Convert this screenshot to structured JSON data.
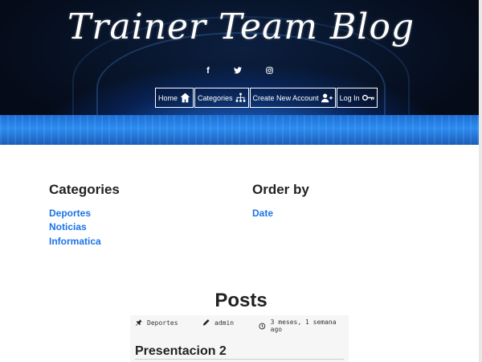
{
  "header": {
    "brand": "Trainer Team Blog",
    "social": [
      {
        "icon": "facebook-icon",
        "glyph": "f"
      },
      {
        "icon": "twitter-icon"
      },
      {
        "icon": "instagram-icon"
      }
    ],
    "nav": [
      {
        "label": "Home",
        "icon": "home-icon"
      },
      {
        "label": "Categories",
        "icon": "sitemap-icon"
      },
      {
        "label": "Create New Account",
        "icon": "user-plus-icon"
      },
      {
        "label": "Log In",
        "icon": "key-icon"
      }
    ]
  },
  "categories": {
    "title": "Categories",
    "items": [
      "Deportes",
      "Noticias",
      "Informatica"
    ]
  },
  "order_by": {
    "title": "Order by",
    "items": [
      "Date"
    ]
  },
  "posts": {
    "title": "Posts",
    "items": [
      {
        "category": "Deportes",
        "author": "admin",
        "time": "3 meses, 1 semana ago",
        "title": "Presentacion 2"
      }
    ]
  },
  "colors": {
    "link": "#1a73e8",
    "header_dark": "#050b18",
    "header_blue": "#2d8cf0"
  }
}
